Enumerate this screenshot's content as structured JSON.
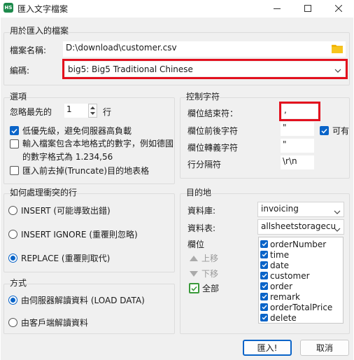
{
  "window": {
    "icon_text": "HS",
    "title": "匯入文字檔案"
  },
  "file_group": {
    "title": "用於匯入的檔案",
    "filename_label": "檔案名稱:",
    "filename_value": "D:\\download\\customer.csv",
    "encoding_label": "編碼:",
    "encoding_value": "big5: Big5 Traditional Chinese"
  },
  "options": {
    "title": "選項",
    "skip_label": "忽略最先的",
    "skip_value": "1",
    "skip_unit": "行",
    "low_priority": {
      "label": "低優先級，避免伺服器高負載",
      "checked": true
    },
    "local_number": {
      "line1": "輸入檔案包含本地格式的數字，例如德國",
      "line2": "的數字格式為 1.234,56",
      "checked": false
    },
    "truncate": {
      "label": "匯入前去掉(Truncate)目的地表格",
      "checked": false
    }
  },
  "control_chars": {
    "title": "控制字符",
    "field_terminator_label": "欄位結束符：",
    "field_terminator_value": ",",
    "enclosed_label": "欄位前後字符",
    "enclosed_value": "\"",
    "optional_label": "可有",
    "optional_checked": true,
    "escaped_label": "欄位轉義字符",
    "escaped_value": "\"",
    "line_terminator_label": "行分隔符",
    "line_terminator_value": "\\r\\n"
  },
  "duplicates": {
    "title": "如何處理衝突的行",
    "options": [
      {
        "label": "INSERT (可能導致出錯)",
        "selected": false
      },
      {
        "label": "INSERT IGNORE (重覆則忽略)",
        "selected": false
      },
      {
        "label": "REPLACE (重覆則取代)",
        "selected": true
      }
    ]
  },
  "method": {
    "title": "方式",
    "options": [
      {
        "label": "由伺服器解讀資料 (LOAD DATA)",
        "selected": true
      },
      {
        "label": "由客戶端解讀資料",
        "selected": false
      }
    ]
  },
  "destination": {
    "title": "目的地",
    "database_label": "資料庫:",
    "database_value": "invoicing",
    "table_label": "資料表:",
    "table_value": "allsheetstoragecu",
    "columns_label": "欄位",
    "move_up": "上移",
    "move_down": "下移",
    "all_label": "全部",
    "columns": [
      "orderNumber",
      "time",
      "date",
      "customer",
      "order",
      "remark",
      "orderTotalPrice",
      "delete"
    ]
  },
  "buttons": {
    "import": "匯入!",
    "cancel": "取消"
  },
  "colors": {
    "accent": "#0a64c8",
    "highlight_box": "#e3101e",
    "folder": "#f2b400",
    "all_check": "#3a9a3a"
  }
}
